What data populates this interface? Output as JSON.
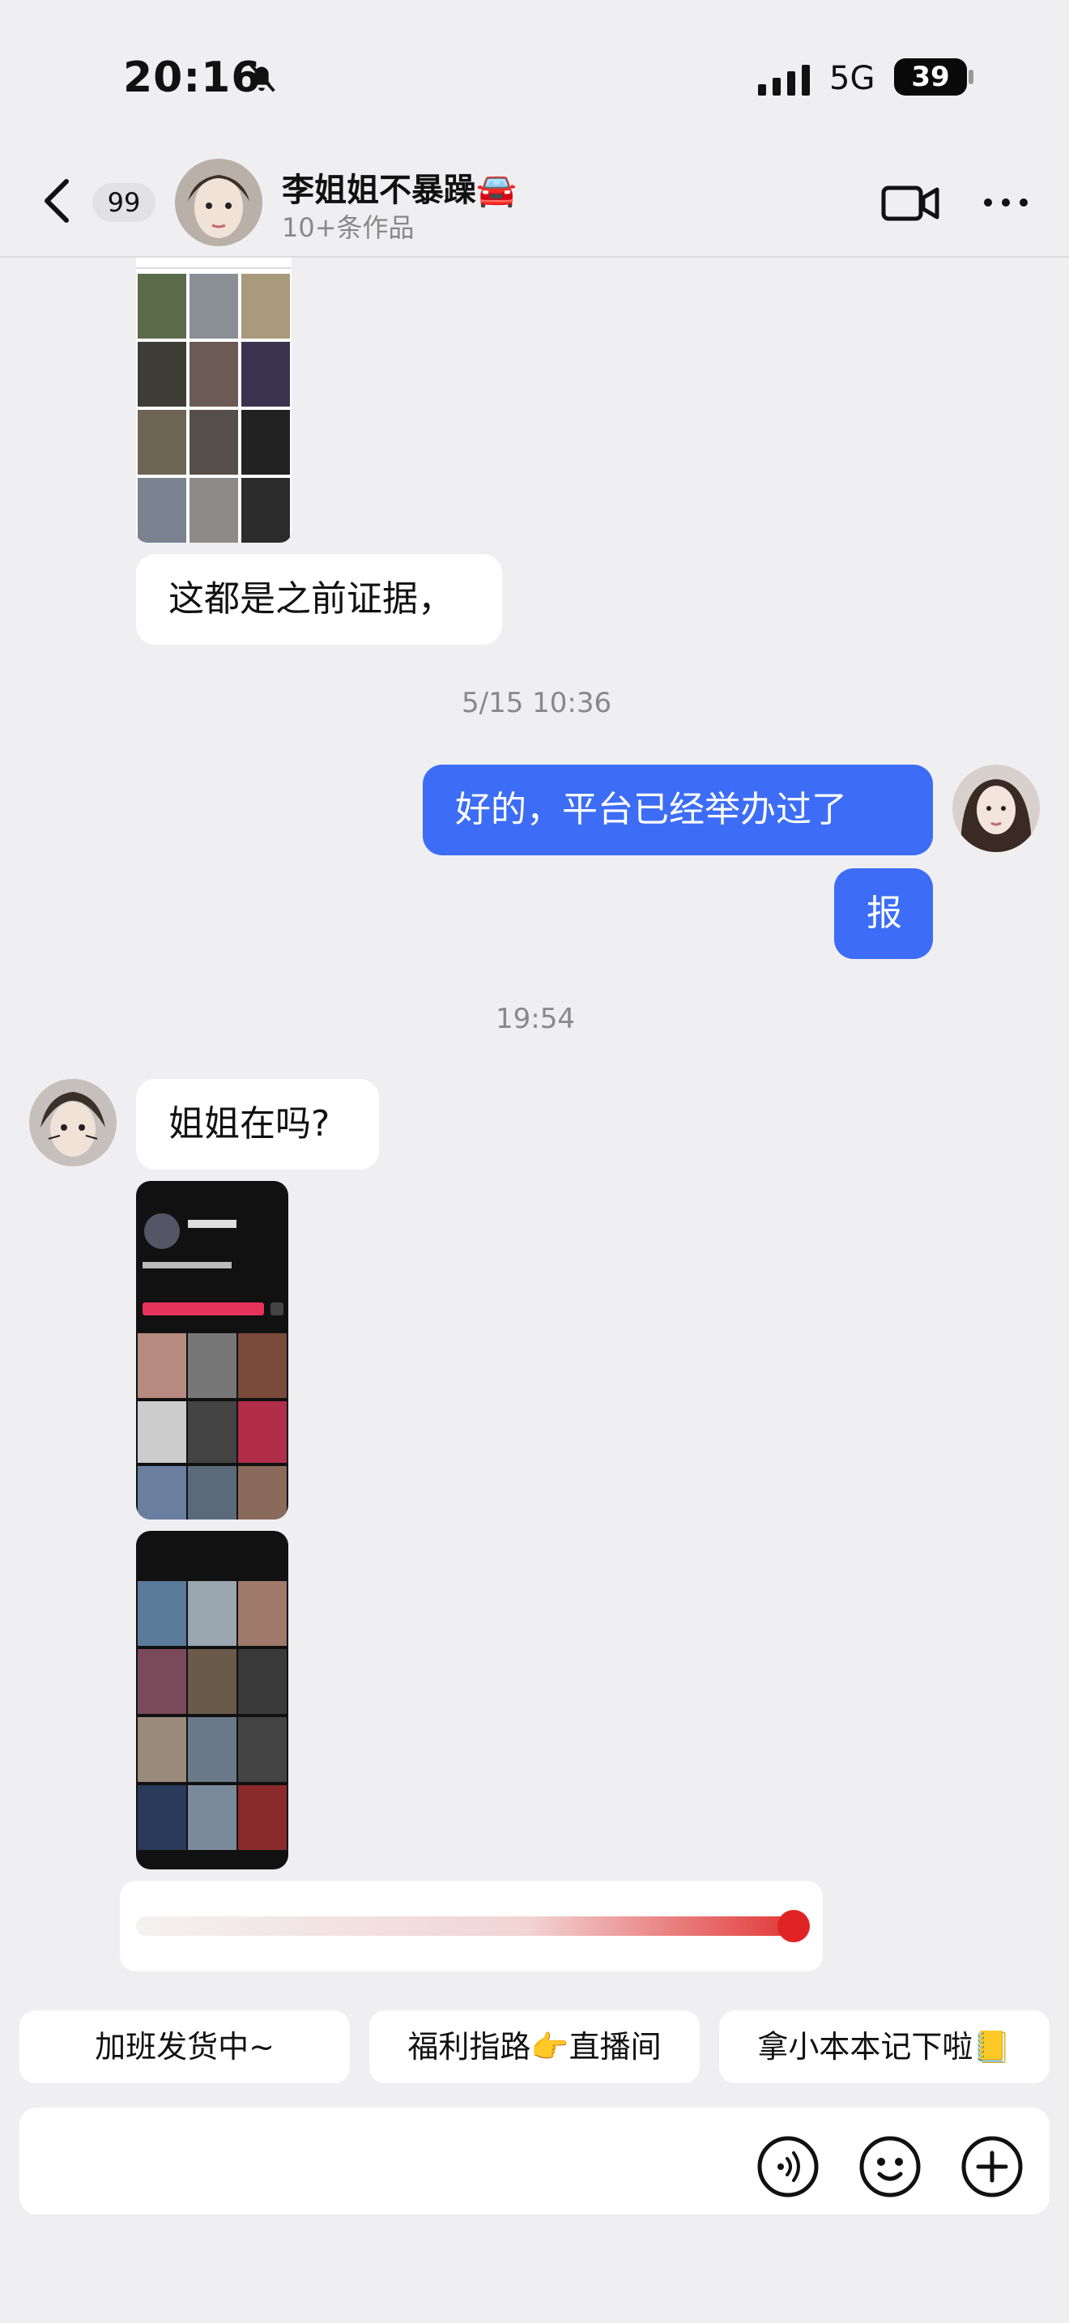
{
  "status": {
    "time": "20:16",
    "network": "5G",
    "battery": "39"
  },
  "header": {
    "unread_count": "99",
    "contact_name": "李姐姐不暴躁🚘",
    "subtitle": "10+条作品"
  },
  "messages": {
    "m1_text": "这都是之前证据，",
    "ts1": "5/15 10:36",
    "m2_text": "好的，平台已经举办过了",
    "m3_text": "报",
    "ts2": "19:54",
    "m4_text": "姐姐在吗?"
  },
  "quick_replies": [
    "加班发货中~",
    "福利指路👉直播间",
    "拿小本本记下啦📒"
  ],
  "colors": {
    "outgoing_bubble": "#3d6df6",
    "background": "#efeff1"
  }
}
